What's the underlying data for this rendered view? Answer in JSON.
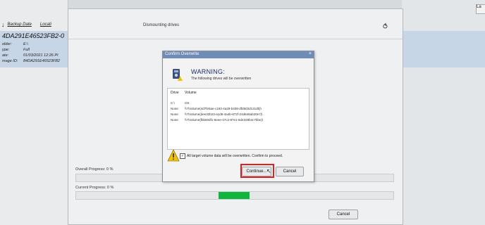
{
  "background_app": {
    "toolbar": {
      "backup_date_label": "Backup Date",
      "location_label": "Locati"
    },
    "selected_image": {
      "id_partial": "4DA291E46523FB2-0",
      "rows": [
        {
          "label": "older:",
          "value": "E:\\"
        },
        {
          "label": "ype:",
          "value": "Full"
        },
        {
          "label": "ate:",
          "value": "01/03/2021 12:26 PI"
        },
        {
          "label": "mage ID:",
          "value": "84DA291E46523FB2"
        }
      ]
    },
    "right_tab": "La"
  },
  "progress_window": {
    "header_title": "Dismounting drives",
    "overall_progress_label": "Overall Progress:  0 %",
    "overall_progress_value": 0,
    "current_progress_label": "Current Progress:  0 %",
    "current_progress_value": 0,
    "cancel_label": "Cancel",
    "accent_green": "#12b53c"
  },
  "dialog": {
    "title": "Confirm Overwrite",
    "warning_title": "WARNING:",
    "warning_subtitle": "The following drives will be overwritten",
    "columns": {
      "drive": "Drive",
      "volume": "Volume"
    },
    "rows": [
      {
        "drive": "C:\\",
        "volume": "OS"
      },
      {
        "drive": "None",
        "volume": "\\\\?\\Volume{4d7fe5ae-c193-4a28-b408-dfd8d3d131db}\\"
      },
      {
        "drive": "None",
        "volume": "\\\\?\\Volume{dee32b23-a1d6-4a4b-872f-24d646ab20e7}\\"
      },
      {
        "drive": "None",
        "volume": "\\\\?\\Volume{fbb60df1-6eee-47c2-87e1-6d4328b4c7bbe}\\"
      }
    ],
    "confirm_text": "All target volume data will be overwritten.  Confirm to proceed.",
    "confirm_checked": true,
    "continue_label": "Continue...",
    "cancel_label": "Cancel",
    "close_glyph": "×",
    "highlight_color": "#e01f1f"
  }
}
